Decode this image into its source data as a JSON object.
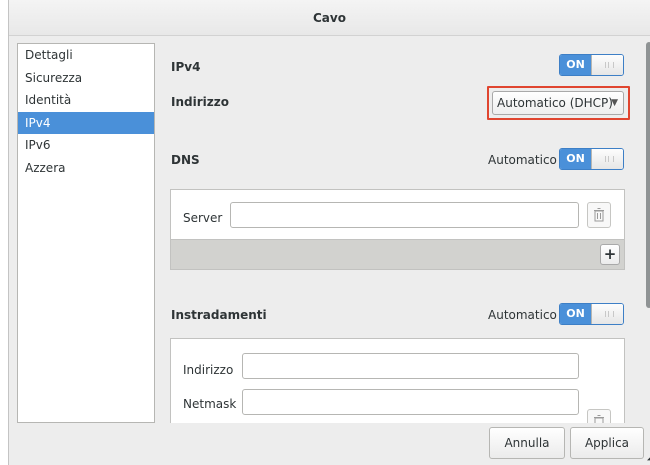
{
  "window": {
    "title": "Cavo"
  },
  "sidebar": {
    "items": [
      {
        "label": "Dettagli"
      },
      {
        "label": "Sicurezza"
      },
      {
        "label": "Identità"
      },
      {
        "label": "IPv4",
        "selected": true
      },
      {
        "label": "IPv6"
      },
      {
        "label": "Azzera"
      }
    ]
  },
  "ipv4": {
    "label": "IPv4",
    "switch": "ON",
    "address_label": "Indirizzo",
    "method": "Automatico (DHCP)"
  },
  "dns": {
    "label": "DNS",
    "auto_label": "Automatico",
    "switch": "ON",
    "server_label": "Server",
    "server_value": "",
    "add_label": "+"
  },
  "routes": {
    "label": "Instradamenti",
    "auto_label": "Automatico",
    "switch": "ON",
    "address_label": "Indirizzo",
    "address_value": "",
    "netmask_label": "Netmask",
    "netmask_value": ""
  },
  "buttons": {
    "cancel": "Annulla",
    "apply": "Applica"
  },
  "colors": {
    "accent": "#4a90d9",
    "highlight": "#e0452f"
  },
  "icons": {
    "trash": "trash-icon",
    "resize": "resize-grip-icon"
  }
}
